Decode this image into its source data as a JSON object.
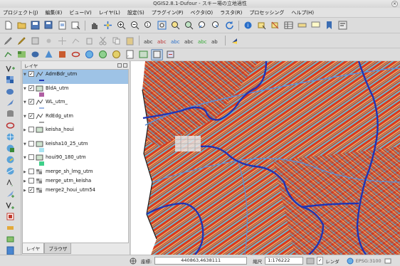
{
  "window": {
    "title": "QGIS2.8.1-Dufour - スキー場の立地適性",
    "close_label": "×"
  },
  "menu": [
    "プロジェクト(J)",
    "編集(E)",
    "ビュー(V)",
    "レイヤ(L)",
    "設定(S)",
    "プラグイン(P)",
    "ベクタ(O)",
    "ラスタ(R)",
    "プロセッシング",
    "ヘルプ(H)"
  ],
  "layers_panel": {
    "title": "レイヤ",
    "layers": [
      {
        "name": "AdmBdr_utm",
        "checked": true,
        "expanded": true,
        "type": "line",
        "selected": true,
        "legend_color": "#1f35b5"
      },
      {
        "name": "BldA_utm",
        "checked": true,
        "expanded": true,
        "type": "polygon",
        "legend_color": "#b05fa3"
      },
      {
        "name": "WL_utm_",
        "checked": true,
        "expanded": true,
        "type": "line",
        "legend_color": "#3a6ec9"
      },
      {
        "name": "RdEdg_utm",
        "checked": true,
        "expanded": true,
        "type": "line",
        "legend_color": "#444444"
      },
      {
        "name": "keisha_houi",
        "checked": false,
        "expanded": false,
        "type": "polygon",
        "legend_color": ""
      },
      {
        "name": "keisha10_25_utm",
        "checked": false,
        "expanded": true,
        "type": "polygon",
        "legend_color": "#a9e5f2"
      },
      {
        "name": "houi90_180_utm",
        "checked": false,
        "expanded": true,
        "type": "polygon",
        "legend_color": "#3fd08a"
      },
      {
        "name": "merge_sh_lmg_utm",
        "checked": false,
        "expanded": false,
        "type": "raster",
        "legend_color": ""
      },
      {
        "name": "merge_utm_keisha",
        "checked": false,
        "expanded": false,
        "type": "raster",
        "legend_color": ""
      },
      {
        "name": "merge2_houi_utm54",
        "checked": true,
        "expanded": false,
        "type": "raster",
        "legend_color": ""
      }
    ],
    "tabs": [
      "レイヤ",
      "ブラウザ"
    ]
  },
  "statusbar": {
    "coord_label": "座標:",
    "coord_value": "440863,4638111",
    "scale_label": "縮尺",
    "scale_value": "1:176222",
    "render_label": "レンダ",
    "crs": "EPSG:3100"
  },
  "colors": {
    "accent": "#1f35b5",
    "selection": "#9ec3e6",
    "terrain_high": "#d8391e",
    "terrain_low": "#6fb7c9"
  }
}
